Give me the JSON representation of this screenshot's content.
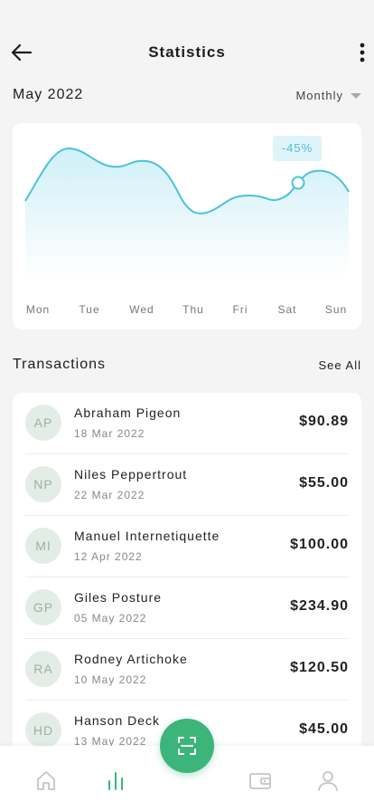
{
  "header": {
    "title": "Statistics"
  },
  "period": {
    "title": "May 2022",
    "select_label": "Monthly"
  },
  "chart_data": {
    "type": "area",
    "x": [
      "Mon",
      "Tue",
      "Wed",
      "Thu",
      "Fri",
      "Sat",
      "Sun"
    ],
    "highlight": {
      "day": "Sat",
      "label": "-45%"
    },
    "colors": {
      "line": "#4cc2d6",
      "fill_top": "#cdeff8",
      "fill_bottom": "#ffffff"
    }
  },
  "transactions": {
    "title": "Transactions",
    "see_all": "See All",
    "items": [
      {
        "initials": "AP",
        "name": "Abraham Pigeon",
        "date": "18 Mar 2022",
        "amount": "$90.89"
      },
      {
        "initials": "NP",
        "name": "Niles Peppertrout",
        "date": "22 Mar 2022",
        "amount": "$55.00"
      },
      {
        "initials": "MI",
        "name": "Manuel Internetiquette",
        "date": "12 Apr 2022",
        "amount": "$100.00"
      },
      {
        "initials": "GP",
        "name": "Giles Posture",
        "date": "05 May 2022",
        "amount": "$234.90"
      },
      {
        "initials": "RA",
        "name": "Rodney Artichoke",
        "date": "10 May 2022",
        "amount": "$120.50"
      },
      {
        "initials": "HD",
        "name": "Hanson Deck",
        "date": "13 May 2022",
        "amount": "$45.00"
      }
    ]
  },
  "nav": {
    "items": [
      "home-icon",
      "statistics-icon",
      "scan-icon",
      "wallet-icon",
      "profile-icon"
    ],
    "active": "statistics-icon",
    "accent": "#3cb57a",
    "inactive": "#c4c4c4"
  }
}
